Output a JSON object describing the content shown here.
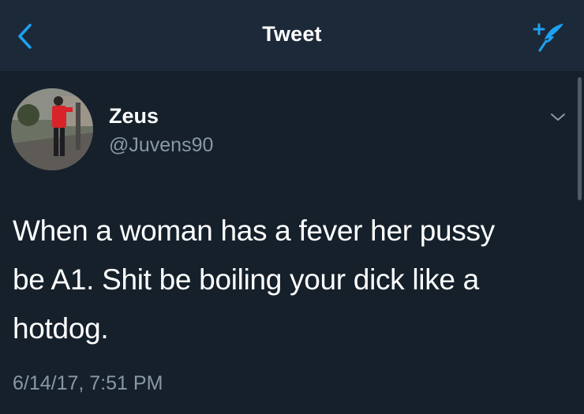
{
  "header": {
    "title": "Tweet",
    "back_icon": "chevron-left-icon",
    "compose_icon": "compose-tweet-icon",
    "accent_color": "#1da1f2"
  },
  "tweet": {
    "author": {
      "name": "Zeus",
      "handle": "@Juvens90"
    },
    "text_lines": [
      "When a woman has a fever her pussy",
      "be A1. Shit be boiling your dick like a",
      "hotdog."
    ],
    "timestamp": "6/14/17, 7:51 PM",
    "menu_icon": "chevron-down-icon"
  },
  "colors": {
    "background": "#15202b",
    "navbar": "#1c2938",
    "text_primary": "#ffffff",
    "text_secondary": "#8899a6"
  }
}
